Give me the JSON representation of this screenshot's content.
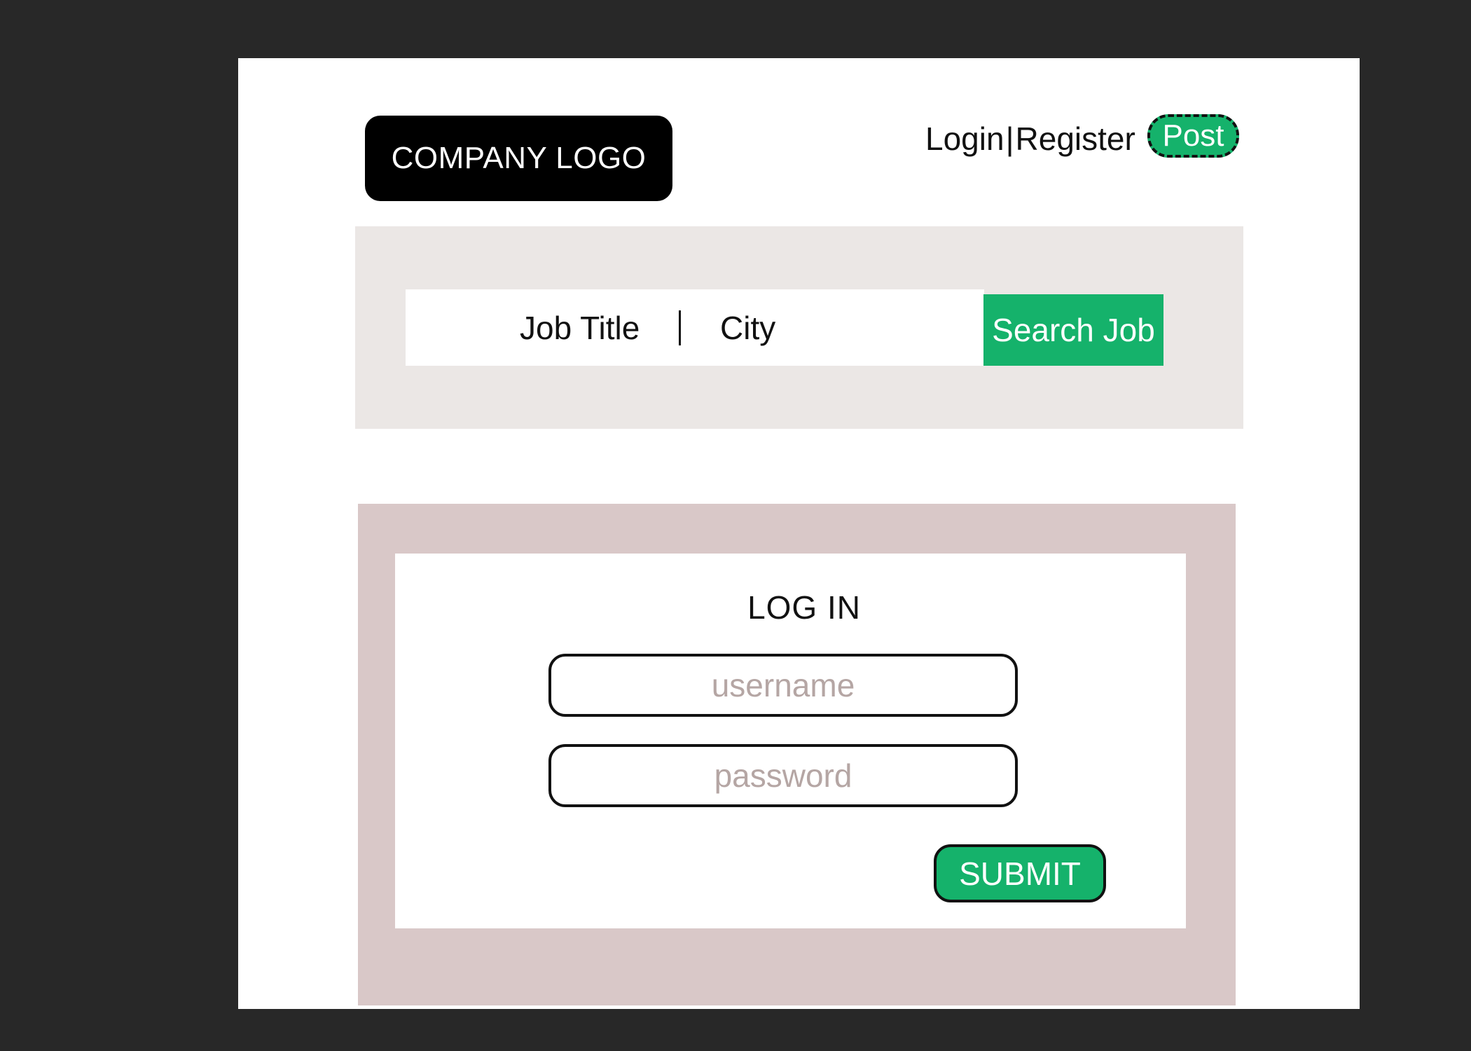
{
  "header": {
    "logo_text": "COMPANY LOGO",
    "login_label": "Login",
    "separator": "|",
    "register_label": "Register",
    "post_label": "Post"
  },
  "search": {
    "job_title_placeholder": "Job Title",
    "divider": "|",
    "city_placeholder": "City",
    "button_label": "Search Job"
  },
  "login": {
    "title": "LOG IN",
    "username_placeholder": "username",
    "password_placeholder": "password",
    "submit_label": "SUBMIT"
  },
  "colors": {
    "accent": "#15b26b",
    "outer_background": "#282828",
    "search_band": "#ebe7e5",
    "login_band": "#d9c8c8",
    "placeholder_text": "#b5a6a4"
  }
}
